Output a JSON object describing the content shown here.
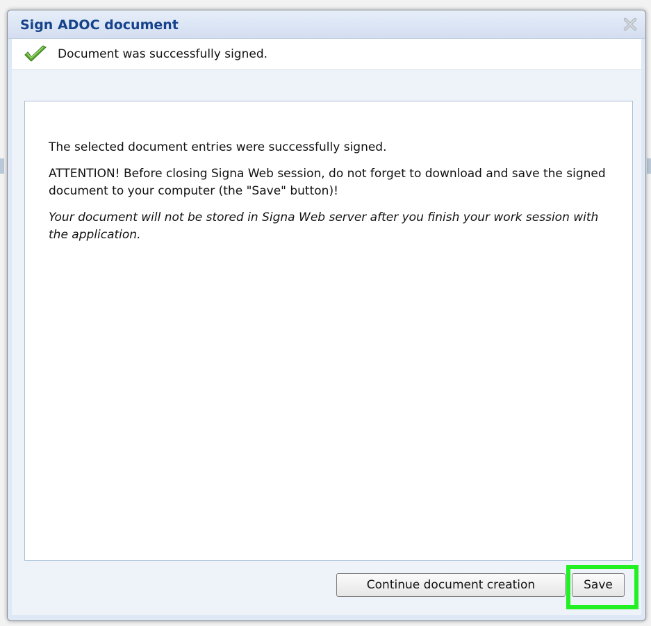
{
  "dialog": {
    "title": "Sign ADOC document",
    "close_icon": "close-icon"
  },
  "status": {
    "icon": "checkmark-icon",
    "message": "Document was successfully signed."
  },
  "content": {
    "line1": "The selected document entries were successfully signed.",
    "line2": "ATTENTION! Before closing Signa Web session, do not forget to download and save the signed document to your computer (the \"Save\" button)!",
    "line3": "Your document will not be stored in Signa Web server after you finish your work session with the application."
  },
  "buttons": {
    "continue_label": "Continue document creation",
    "save_label": "Save"
  },
  "colors": {
    "title": "#15428b",
    "highlight": "#22f022",
    "check": "#5aa832"
  }
}
